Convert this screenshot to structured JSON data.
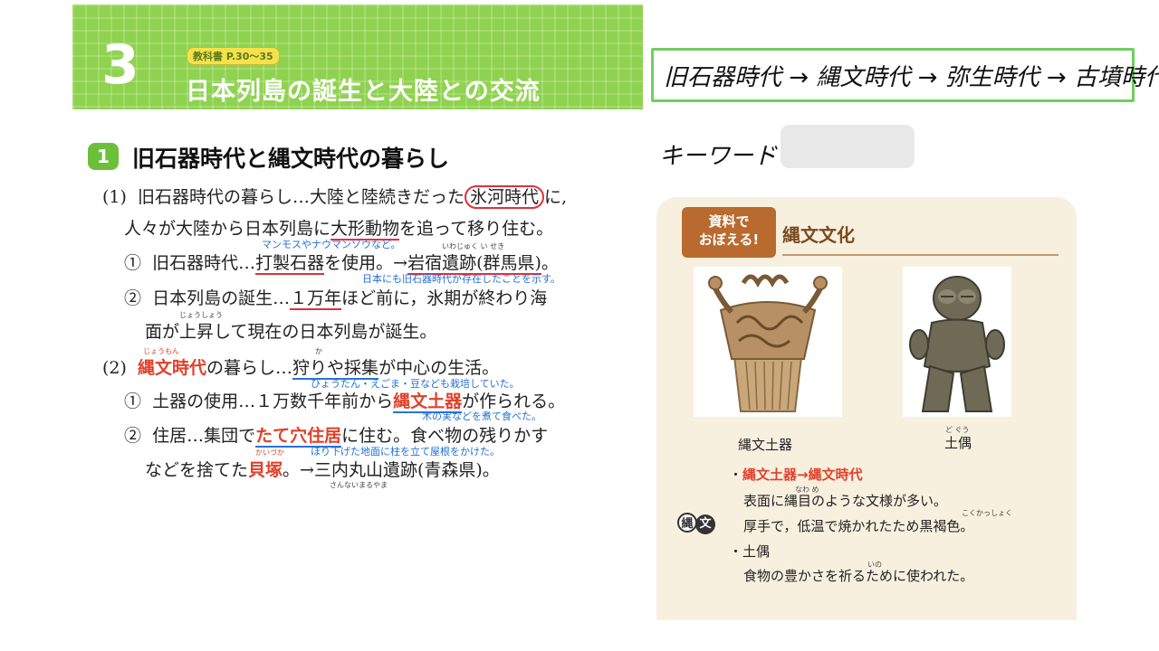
{
  "header": {
    "chapter_number": "3",
    "textbook_ref": "教科書 P.30～35",
    "chapter_title": "日本列島の誕生と大陸との交流"
  },
  "section": {
    "number": "1",
    "title": "旧石器時代と縄文時代の暮らし"
  },
  "body": {
    "p1_num": "(1)",
    "p1_l1_a": "旧石器時代の暮らし…大陸と陸続きだった",
    "p1_l1_b": "氷河時代",
    "p1_l1_c": "に,",
    "p1_l2_a": "人々が大陸から日本列島に",
    "p1_l2_b": "大形動物",
    "p1_l2_c": "を追って移り住む。",
    "note_mammoth": "マンモスやナウマンゾウなど。",
    "ruby_iwajuku": "いわじゅく い せき",
    "i1_num": "①",
    "i1_a": "旧石器時代…",
    "i1_b": "打製石器",
    "i1_c": "を使用。→",
    "i1_d": "岩宿遺跡(群馬県)",
    "i1_e": "。",
    "note_paleo": "日本にも旧石器時代が存在したことを示す。",
    "i2_num": "②",
    "i2_a": "日本列島の誕生…",
    "i2_b": "１万年",
    "i2_c": "ほど前に，氷期が終わり海",
    "ruby_joushou": "じょうしょう",
    "i2_l2": "面が上昇して現在の日本列島が誕生。",
    "ruby_joumon": "じょうもん",
    "ruby_ka": "か",
    "p2_num": "(2)",
    "p2_a": "縄文時代",
    "p2_b": "の暮らし…",
    "p2_c": "狩りや採集",
    "p2_d": "が中心の生活。",
    "note_hyoutan": "ひょうたん・えごま・豆なども栽培していた。",
    "j1_num": "①",
    "j1_a": "土器の使用…１万数千年前から",
    "j1_b": "縄文土器",
    "j1_c": "が作られる。",
    "note_konomi": "木の実などを煮て食べた。",
    "j2_num": "②",
    "j2_a": "住居…集団で",
    "j2_b": "たて穴住居",
    "j2_c": "に住む。食べ物の残りかす",
    "ruby_kaizuka": "かいづか",
    "note_horisage": "ほり下げた地面に柱を立て屋根をかけた。",
    "j2_l2_a": "などを捨てた",
    "j2_l2_b": "貝塚",
    "j2_l2_c": "。→三内丸山遺跡(青森県)。",
    "ruby_sannai": "さんないまるやま"
  },
  "timeline": "旧石器時代 → 縄文時代 → 弥生時代 → 古墳時代",
  "keyword": {
    "label": "キーワード："
  },
  "panel": {
    "tab_line1": "資料で",
    "tab_line2": "おぼえる!",
    "title": "縄文文化",
    "caption1": "縄文土器",
    "caption2": "土偶",
    "ruby_dogu": "ど ぐう",
    "badge_a": "縄",
    "badge_b": "文",
    "b1_a": "・",
    "b1_b": "縄文土器→縄文時代",
    "ruby_nawame": "なわ め",
    "b1_l2": "表面に縄目のような文様が多い。",
    "ruby_kokkasshoku": "こくかっしょく",
    "b1_l3": "厚手で，低温で焼かれたため黒褐色。",
    "b2": "・土偶",
    "ruby_ino": "いの",
    "b2_l2": "食物の豊かさを祈るために使われた。"
  },
  "colors": {
    "banner": "#8fd24f",
    "accent_red": "#e0402a",
    "note_blue": "#1f6fd6",
    "panel_bg": "#f8f0df",
    "tab_brown": "#b96a2e"
  }
}
